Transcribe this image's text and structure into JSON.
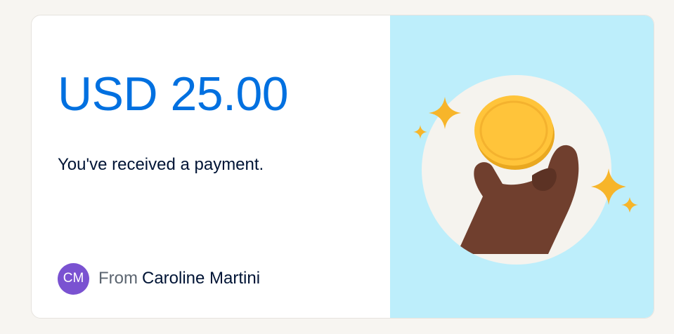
{
  "payment": {
    "amount": "USD 25.00",
    "message": "You've received a payment.",
    "sender_initials": "CM",
    "from_label": "From",
    "sender_name": "Caroline Martini"
  },
  "colors": {
    "amount": "#0070e0",
    "avatar": "#7a52d1",
    "illustration_bg": "#bdeefb",
    "coin": "#ffc43a",
    "sparkle": "#f7b52a",
    "hand": "#703f2e"
  },
  "illustration": {
    "icons": [
      "hand-icon",
      "coin-icon",
      "sparkle-icon"
    ]
  }
}
